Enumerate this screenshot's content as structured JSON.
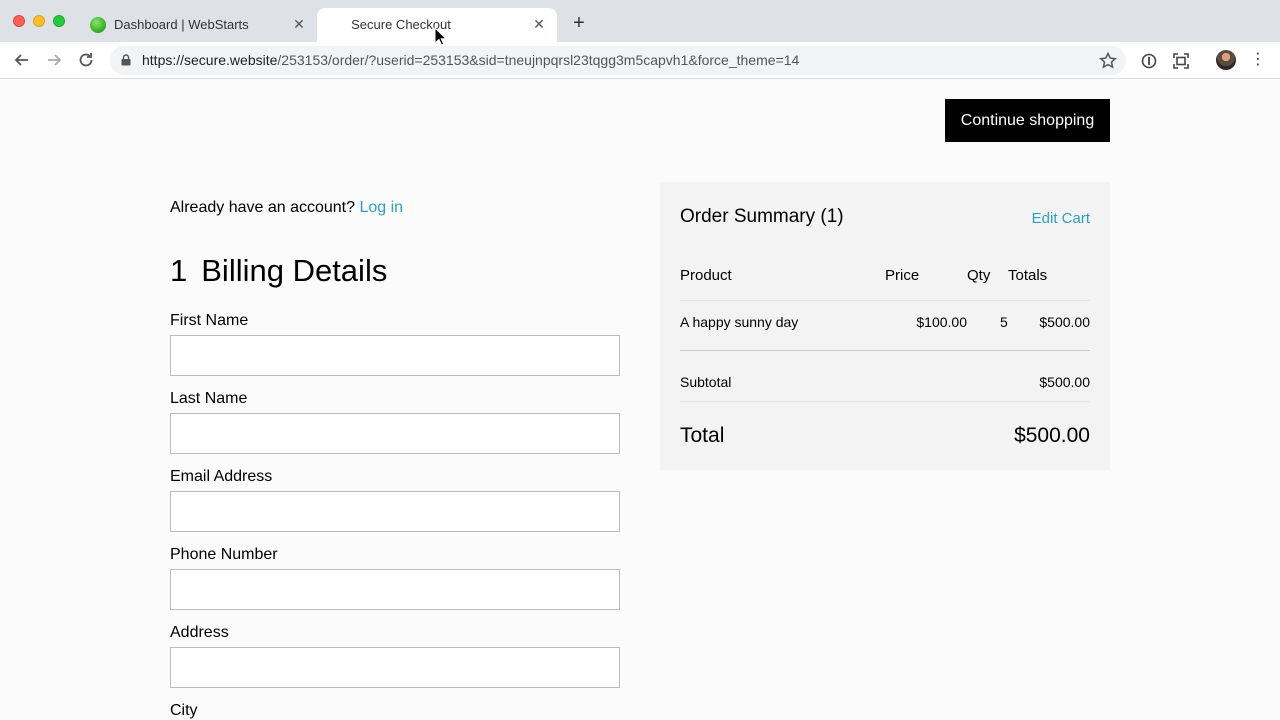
{
  "browser": {
    "tabs": [
      {
        "title": "Dashboard | WebStarts",
        "active": false
      },
      {
        "title": "Secure Checkout",
        "active": true
      }
    ],
    "url_host": "https://secure.website",
    "url_path": "/253153/order/?userid=253153&sid=tneujnpqrsl23tqgg3m5capvh1&force_theme=14"
  },
  "header": {
    "continue_label": "Continue shopping"
  },
  "account": {
    "prompt": "Already have an account?",
    "login_label": "Log in"
  },
  "billing": {
    "step_number": "1",
    "title": "Billing Details",
    "fields": {
      "first_name": {
        "label": "First Name",
        "value": ""
      },
      "last_name": {
        "label": "Last Name",
        "value": ""
      },
      "email": {
        "label": "Email Address",
        "value": ""
      },
      "phone": {
        "label": "Phone Number",
        "value": ""
      },
      "address": {
        "label": "Address",
        "value": ""
      },
      "city": {
        "label": "City"
      }
    }
  },
  "summary": {
    "title": "Order Summary (1)",
    "edit_label": "Edit Cart",
    "columns": {
      "product": "Product",
      "price": "Price",
      "qty": "Qty",
      "totals": "Totals"
    },
    "items": [
      {
        "product": "A happy sunny day",
        "price": "$100.00",
        "qty": "5",
        "total": "$500.00"
      }
    ],
    "subtotal_label": "Subtotal",
    "subtotal_value": "$500.00",
    "total_label": "Total",
    "total_value": "$500.00"
  },
  "colors": {
    "link": "#2f9ec7",
    "button_bg": "#000000",
    "summary_bg": "#f3f3f3"
  }
}
